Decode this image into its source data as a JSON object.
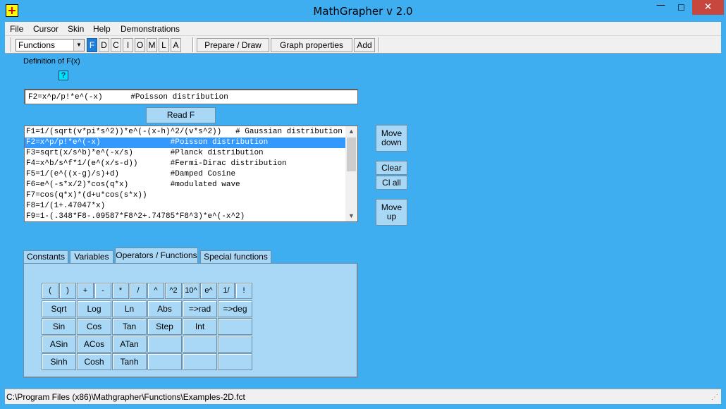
{
  "window": {
    "title": "MathGrapher v 2.0",
    "app_icon": "+",
    "minimize": "—",
    "maximize": "☐",
    "close": "✕"
  },
  "menu": [
    "File",
    "Cursor",
    "Skin",
    "Help",
    "Demonstrations"
  ],
  "toolbar": {
    "mode_selected": "Functions",
    "mode_buttons": [
      "F",
      "D",
      "C",
      "I",
      "O",
      "M",
      "L",
      "A"
    ],
    "selected_mode_button": "F",
    "prepare_draw": "Prepare / Draw",
    "graph_properties": "Graph properties",
    "add": "Add"
  },
  "definition": {
    "label": "Definition of F(x)",
    "help": "?",
    "value": "F2=x^p/p!*e^(-x)      #Poisson distribution",
    "read_button": "Read F"
  },
  "function_list": {
    "selected_index": 1,
    "items": [
      "F1=1/(sqrt(v*pi*s^2))*e^(-(x-h)^2/(v*s^2))   # Gaussian distribution",
      "F2=x^p/p!*e^(-x)               #Poisson distribution",
      "F3=sqrt(x/s^b)*e^(-x/s)        #Planck distribution",
      "F4=x^b/s^f*1/(e^(x/s-d))       #Fermi-Dirac distribution",
      "F5=1/(e^((x-g)/s)+d)           #Damped Cosine",
      "F6=e^(-s*x/2)*cos(q*x)         #modulated wave",
      "F7=cos(q*x)*(d+u*cos(s*x))",
      "F8=1/(1+.47047*x)",
      "F9=1-(.348*F8-.09587*F8^2+.74785*F8^3)*e^(-x^2)"
    ]
  },
  "side_buttons": {
    "move_down": [
      "Move",
      "down"
    ],
    "clear": "Clear",
    "clear_all": "Cl all",
    "move_up": [
      "Move",
      "up"
    ]
  },
  "tabs": {
    "items": [
      "Constants",
      "Variables",
      "Operators / Functions",
      "Special functions"
    ],
    "selected": "Operators / Functions"
  },
  "operators": [
    "(",
    ")",
    "+",
    "-",
    "*",
    "/",
    "^",
    "^2",
    "10^",
    "e^",
    "1/",
    "!"
  ],
  "functions": [
    [
      "Sqrt",
      "Log",
      "Ln",
      "Abs",
      "=>rad",
      "=>deg"
    ],
    [
      "Sin",
      "Cos",
      "Tan",
      "Step",
      "Int",
      ""
    ],
    [
      "ASin",
      "ACos",
      "ATan",
      "",
      "",
      ""
    ],
    [
      "Sinh",
      "Cosh",
      "Tanh",
      "",
      "",
      ""
    ]
  ],
  "status": {
    "path": "C:\\Program Files (x86)\\Mathgrapher\\Functions\\Examples-2D.fct"
  }
}
